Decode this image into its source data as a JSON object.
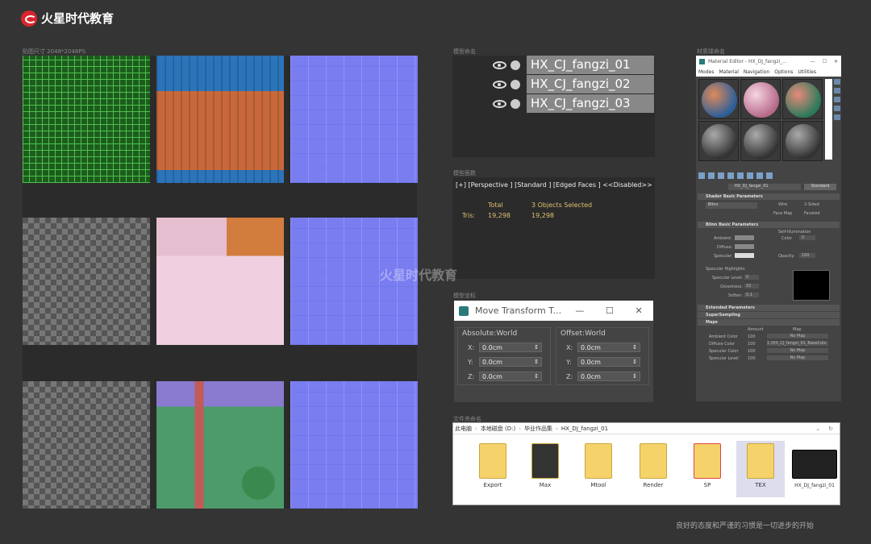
{
  "brand": {
    "name": "火星时代教育",
    "watermark": "火星时代教育"
  },
  "captions": {
    "uv_textures": "贴图尺寸 2048*2048PS",
    "layers": "模型命名",
    "viewport": "模型面数",
    "transform": "模型坐标",
    "material": "材质球命名",
    "folders": "文件夹命名"
  },
  "layers": {
    "items": [
      "HX_CJ_fangzi_01",
      "HX_CJ_fangzi_02",
      "HX_CJ_fangzi_03"
    ]
  },
  "viewport": {
    "header": "[+] [Perspective ] [Standard ] [Edged Faces ]  <<Disabled>>",
    "total_label": "Total",
    "selected_label": "3 Objects Selected",
    "tris_label": "Tris:",
    "tris_total": "19,298",
    "tris_selected": "19,298"
  },
  "transform": {
    "title": "Move Transform T...",
    "absolute_label": "Absolute:World",
    "offset_label": "Offset:World",
    "axes": [
      "X:",
      "Y:",
      "Z:"
    ],
    "absolute_values": [
      "0.0cm",
      "0.0cm",
      "0.0cm"
    ],
    "offset_values": [
      "0.0cm",
      "0.0cm",
      "0.0cm"
    ]
  },
  "material_editor": {
    "title": "Material Editor - HX_DJ_fangzi_...",
    "menu": [
      "Modes",
      "Material",
      "Navigation",
      "Options",
      "Utilities"
    ],
    "material_name": "HX_DJ_fangzi_01",
    "material_type": "Standard",
    "rollouts": {
      "shader": "Shader Basic Parameters",
      "blinn": "Blinn Basic Parameters",
      "extended": "Extended Parameters",
      "supersampling": "SuperSampling",
      "maps": "Maps"
    },
    "shader_type": "Blinn",
    "shader_options": [
      "Wire",
      "2-Sided",
      "Face Map",
      "Faceted"
    ],
    "self_illum_label": "Self-Illumination",
    "color_label": "Color",
    "color_value": "0",
    "opacity_label": "Opacity:",
    "opacity_value": "100",
    "ambient_label": "Ambient:",
    "diffuse_label": "Diffuse:",
    "specular_label": "Specular:",
    "specular_highlights": "Specular Highlights",
    "specular_level_label": "Specular Level:",
    "specular_level_value": "0",
    "glossiness_label": "Glossiness:",
    "glossiness_value": "10",
    "soften_label": "Soften:",
    "soften_value": "0.1",
    "maps_headers": [
      "Amount",
      "Map"
    ],
    "maps_rows": [
      {
        "name": "Ambient Color",
        "amount": "100",
        "map": "No Map"
      },
      {
        "name": "Diffuse Color",
        "amount": "100",
        "map": "1 (HX_CJ_fangzi_01_BaseColo"
      },
      {
        "name": "Specular Color",
        "amount": "100",
        "map": "No Map"
      },
      {
        "name": "Specular Level",
        "amount": "100",
        "map": "No Map"
      }
    ]
  },
  "explorer": {
    "breadcrumb": [
      "此电脑",
      "本地磁盘 (D:)",
      "毕业作品集",
      "HX_DJ_fangzi_01"
    ],
    "folders": [
      "Export",
      "Max",
      "Mtool",
      "Render",
      "SP",
      "TEX",
      "HX_DJ_fangzi_01"
    ]
  },
  "footer": "良好的态度和严谨的习惯是一切进步的开始",
  "colors": {
    "background": "#343434",
    "brand_red": "#d7262e",
    "uv_green": "#4fbf4f",
    "normal_blue": "#7a7df0"
  }
}
